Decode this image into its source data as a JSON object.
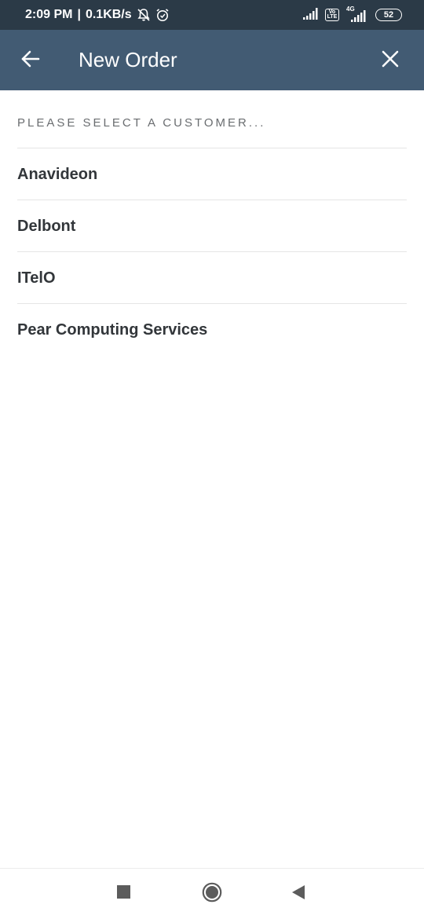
{
  "status_bar": {
    "time": "2:09 PM",
    "separator": "|",
    "speed": "0.1KB/s",
    "volte_top": "Vo",
    "volte_bottom": "LTE",
    "network_tag": "4G",
    "battery": "52",
    "icons": [
      "notifications-off-icon",
      "alarm-icon",
      "signal-icon",
      "volte-icon",
      "4g-signal-icon",
      "battery-icon"
    ]
  },
  "app_bar": {
    "title": "New Order",
    "back_icon": "arrow-left-icon",
    "close_icon": "close-icon"
  },
  "customer_list": {
    "header": "PLEASE SELECT A CUSTOMER...",
    "items": [
      {
        "label": "Anavideon"
      },
      {
        "label": "Delbont"
      },
      {
        "label": "ITelO"
      },
      {
        "label": "Pear Computing Services"
      }
    ]
  },
  "nav_bar": {
    "icons": [
      "recents-square-icon",
      "home-circle-icon",
      "back-triangle-icon"
    ]
  },
  "colors": {
    "status_bar": "#2b3a47",
    "app_bar": "#425b73",
    "item_text": "#32363a",
    "label_text": "#6a6d70",
    "divider": "#e5e5e5"
  }
}
